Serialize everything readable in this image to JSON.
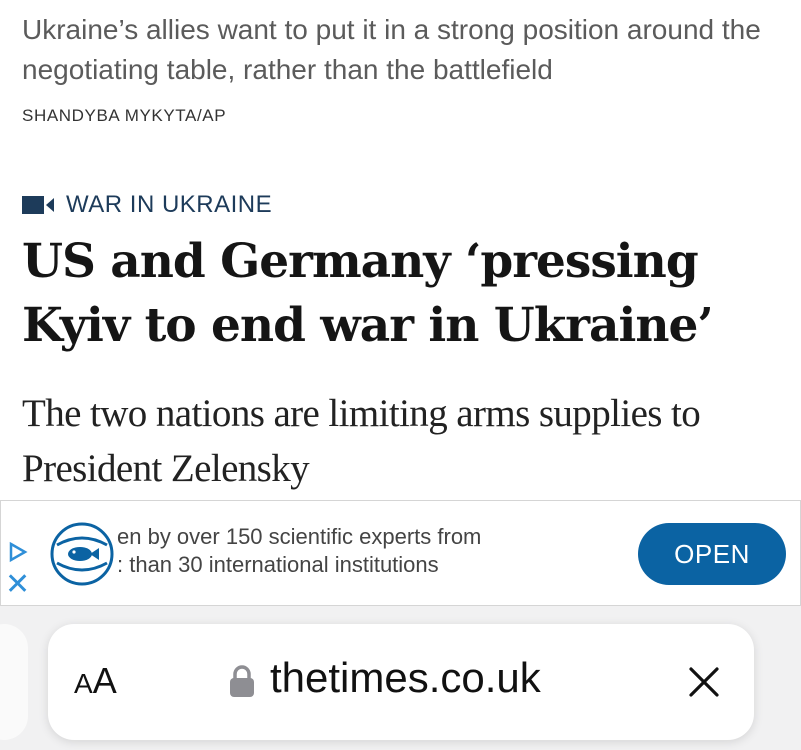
{
  "article": {
    "image_caption": "Ukraine’s allies want to put it in a strong position around the negotiating table, rather than the battlefield",
    "image_credit": "SHANDYBA MYKYTA/AP",
    "section_label": "WAR IN UKRAINE",
    "section_icon": "video-camera-icon",
    "headline": "US and Germany ‘pressing Kyiv to end war in Ukraine’",
    "standfirst": "The two nations are limiting arms supplies to President Zelensky"
  },
  "ad": {
    "text_line_1": "en by over 150 scientific experts from",
    "text_line_2": ": than 30 international institutions",
    "open_label": "OPEN",
    "close_glyph": "✕",
    "logo_icon": "fish-globe-icon",
    "accent_color": "#0b63a3"
  },
  "browser": {
    "reader_label_small": "A",
    "reader_label_large": "A",
    "domain": "thetimes.co.uk",
    "lock_icon": "lock-icon",
    "close_icon": "close-icon"
  },
  "colors": {
    "section_label": "#1d3b5a",
    "headline": "#151515",
    "toolbar_background": "#f1f1f2"
  }
}
